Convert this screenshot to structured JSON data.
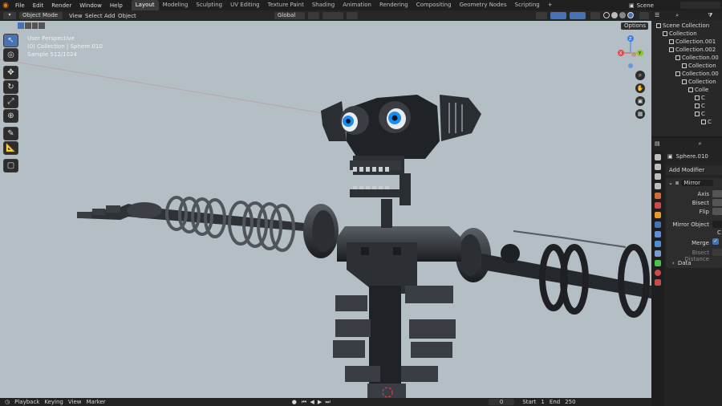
{
  "menu": [
    "File",
    "Edit",
    "Render",
    "Window",
    "Help"
  ],
  "workspaces": [
    {
      "label": "Layout",
      "active": true
    },
    {
      "label": "Modeling"
    },
    {
      "label": "Sculpting"
    },
    {
      "label": "UV Editing"
    },
    {
      "label": "Texture Paint"
    },
    {
      "label": "Shading"
    },
    {
      "label": "Animation"
    },
    {
      "label": "Rendering"
    },
    {
      "label": "Compositing"
    },
    {
      "label": "Geometry Nodes"
    },
    {
      "label": "Scripting"
    },
    {
      "label": "+"
    }
  ],
  "scene_name": "Scene",
  "viewport_header": {
    "mode": "Object Mode",
    "menus": [
      "View",
      "Select",
      "Add",
      "Object"
    ],
    "orientation": "Global",
    "options_label": "Options"
  },
  "overlay_text": {
    "perspective": "User Perspective",
    "collection": "(0) Collection | Sphere.010",
    "sample": "Sample 512/1024"
  },
  "gizmo": {
    "z": "Z",
    "y": "Y",
    "x": "X"
  },
  "timeline": {
    "playback": "Playback",
    "keying": "Keying",
    "view": "View",
    "marker": "Marker",
    "current_frame": "0",
    "start_label": "Start",
    "start": "1",
    "end_label": "End",
    "end": "250"
  },
  "outliner": {
    "rows": [
      {
        "label": "Scene Collection",
        "indent": 0
      },
      {
        "label": "Collection",
        "indent": 1
      },
      {
        "label": "Collection.001",
        "indent": 2
      },
      {
        "label": "Collection.002",
        "indent": 2
      },
      {
        "label": "Collection.00",
        "indent": 3
      },
      {
        "label": "Collection",
        "indent": 4
      },
      {
        "label": "Collection.00",
        "indent": 3
      },
      {
        "label": "Collection",
        "indent": 4
      },
      {
        "label": "Colle",
        "indent": 5
      },
      {
        "label": "C",
        "indent": 6
      },
      {
        "label": "C",
        "indent": 6
      },
      {
        "label": "C",
        "indent": 6
      },
      {
        "label": "C",
        "indent": 7
      }
    ]
  },
  "properties": {
    "object_name": "Sphere.010",
    "add_modifier": "Add Modifier",
    "modifier_name": "Mirror",
    "axis": "Axis",
    "bisect": "Bisect",
    "flip": "Flip",
    "mirror_object": "Mirror Object",
    "merge": "Merge",
    "bisect_distance": "Bisect Distance",
    "data": "Data",
    "clipping_short": "C"
  },
  "colors": {
    "accent": "#4772b3",
    "viewport_bg": "#b3bec5",
    "gizmo_x": "#e8464a",
    "gizmo_y": "#8bc81e",
    "gizmo_z": "#3c7fe8"
  }
}
